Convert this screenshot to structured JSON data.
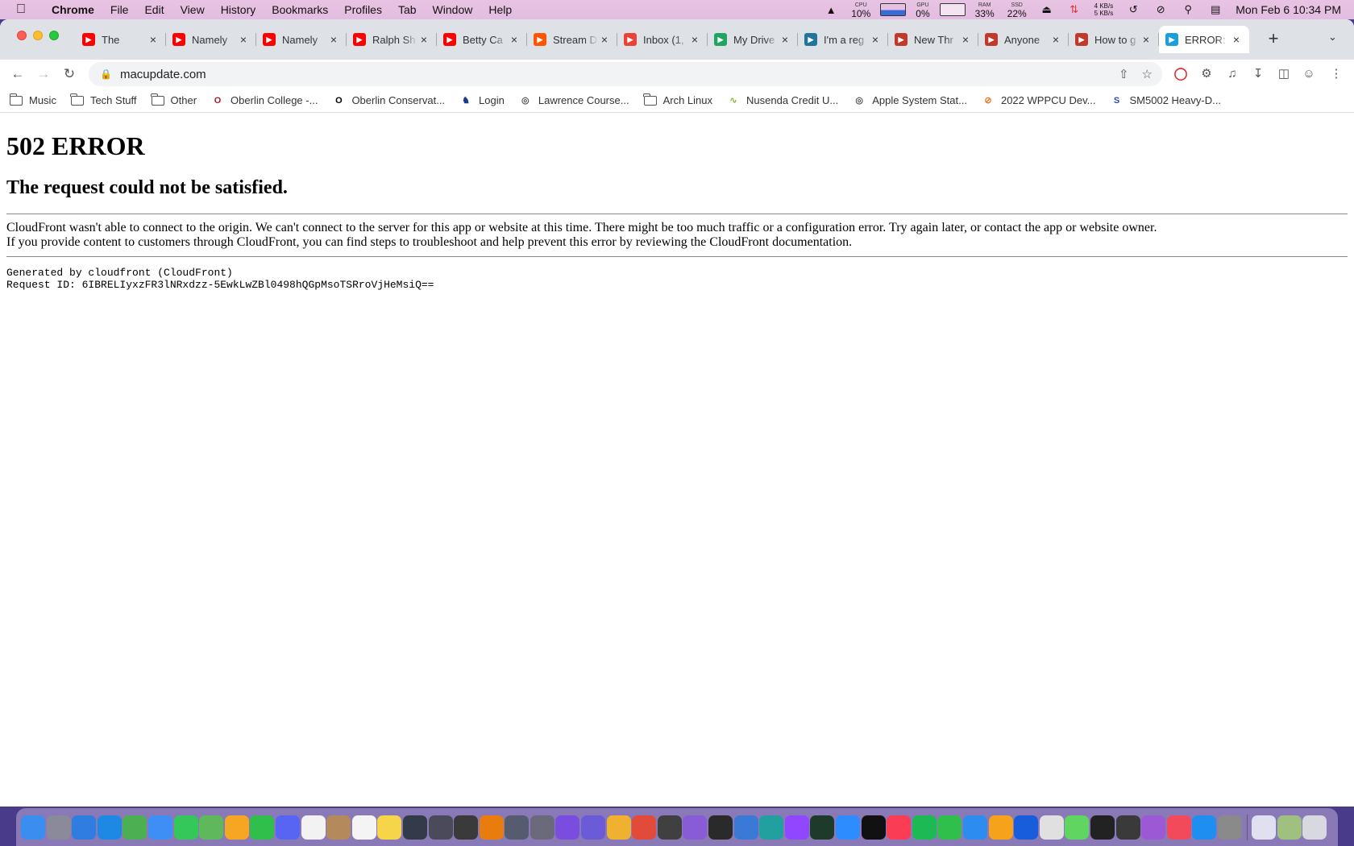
{
  "menubar": {
    "app": "Chrome",
    "items": [
      "File",
      "Edit",
      "View",
      "History",
      "Bookmarks",
      "Profiles",
      "Tab",
      "Window",
      "Help"
    ],
    "cpu": {
      "label": "CPU",
      "value": "10%"
    },
    "gpu": {
      "label": "GPU",
      "value": "0%"
    },
    "ram": {
      "label": "RAM",
      "value": "33%"
    },
    "ssd": {
      "label": "SSD",
      "value": "22%"
    },
    "net_up": "4 KB/s",
    "net_down": "5 KB/s",
    "clock": "Mon Feb 6  10:34 PM"
  },
  "tabs": [
    {
      "title": "The",
      "icon": "youtube-icon",
      "color": "#ff0000"
    },
    {
      "title": "Namely",
      "icon": "youtube-icon",
      "color": "#ff0000"
    },
    {
      "title": "Namely",
      "icon": "youtube-icon",
      "color": "#ff0000"
    },
    {
      "title": "Ralph Sh",
      "icon": "youtube-icon",
      "color": "#ff0000"
    },
    {
      "title": "Betty Ca",
      "icon": "youtube-icon",
      "color": "#ff0000"
    },
    {
      "title": "Stream D",
      "icon": "soundcloud-icon",
      "color": "#ff5500"
    },
    {
      "title": "Inbox (1,",
      "icon": "gmail-icon",
      "color": "#ea4335"
    },
    {
      "title": "My Drive",
      "icon": "google-drive-icon",
      "color": "#1fa463"
    },
    {
      "title": "I'm a reg",
      "icon": "wordpress-icon",
      "color": "#21759b"
    },
    {
      "title": "New Thr",
      "icon": "macrumors-icon",
      "color": "#c0392b"
    },
    {
      "title": "Anyone",
      "icon": "macrumors-icon",
      "color": "#c0392b"
    },
    {
      "title": "How to g",
      "icon": "macrumors-icon",
      "color": "#c0392b"
    },
    {
      "title": "ERROR:",
      "icon": "macupdate-icon",
      "color": "#1a9fd8"
    }
  ],
  "address": "macupdate.com",
  "bookmarks": [
    {
      "label": "Music",
      "icon": "folder-icon"
    },
    {
      "label": "Tech Stuff",
      "icon": "folder-icon"
    },
    {
      "label": "Other",
      "icon": "folder-icon"
    },
    {
      "label": "Oberlin College -...",
      "icon": "oberlin-icon"
    },
    {
      "label": "Oberlin Conservat...",
      "icon": "conservatory-icon"
    },
    {
      "label": "Login",
      "icon": "login-icon"
    },
    {
      "label": "Lawrence Course...",
      "icon": "globe-icon"
    },
    {
      "label": "Arch Linux",
      "icon": "folder-icon"
    },
    {
      "label": "Nusenda Credit U...",
      "icon": "nusenda-icon"
    },
    {
      "label": "Apple System Stat...",
      "icon": "globe-icon"
    },
    {
      "label": "2022 WPPCU Dev...",
      "icon": "wppcu-icon"
    },
    {
      "label": "SM5002 Heavy-D...",
      "icon": "s-icon"
    }
  ],
  "page": {
    "heading": "502 ERROR",
    "subheading": "The request could not be satisfied.",
    "message1": "CloudFront wasn't able to connect to the origin. We can't connect to the server for this app or website at this time. There might be too much traffic or a configuration error. Try again later, or contact the app or website owner.",
    "message2": "If you provide content to customers through CloudFront, you can find steps to troubleshoot and help prevent this error by reviewing the CloudFront documentation.",
    "generated_by": "Generated by cloudfront (CloudFront)",
    "request_id": "Request ID: 6IBRELIyxzFR3lNRxdzz-5EwkLwZBl0498hQGpMsoTSRroVjHeMsiQ=="
  },
  "dock": [
    {
      "icon": "finder-icon",
      "color": "#3a8ef0"
    },
    {
      "icon": "launchpad-icon",
      "color": "#8a8a9a"
    },
    {
      "icon": "files-icon",
      "color": "#2f7de1"
    },
    {
      "icon": "safari-icon",
      "color": "#1e88e5"
    },
    {
      "icon": "chrome-icon",
      "color": "#4caf50"
    },
    {
      "icon": "mail-icon",
      "color": "#3d8ff5"
    },
    {
      "icon": "messages-icon",
      "color": "#34c759"
    },
    {
      "icon": "maps-icon",
      "color": "#5fb85a"
    },
    {
      "icon": "photos-icon",
      "color": "#f6a623"
    },
    {
      "icon": "facetime-icon",
      "color": "#2fbf4a"
    },
    {
      "icon": "discord-icon",
      "color": "#5865f2"
    },
    {
      "icon": "calendar-icon",
      "color": "#f2f2f2"
    },
    {
      "icon": "contacts-icon",
      "color": "#b48a5a"
    },
    {
      "icon": "reminders-icon",
      "color": "#f4f4f4"
    },
    {
      "icon": "notes-icon",
      "color": "#f7d54a"
    },
    {
      "icon": "davinci-icon",
      "color": "#333a4a"
    },
    {
      "icon": "app-icon",
      "color": "#4a4a5a"
    },
    {
      "icon": "app-icon",
      "color": "#3a3a3a"
    },
    {
      "icon": "blender-icon",
      "color": "#e87d0d"
    },
    {
      "icon": "app-icon",
      "color": "#555c70"
    },
    {
      "icon": "app-icon",
      "color": "#6a6a7a"
    },
    {
      "icon": "arc-icon",
      "color": "#7a4de0"
    },
    {
      "icon": "musescore-icon",
      "color": "#6b5bd6"
    },
    {
      "icon": "app-icon",
      "color": "#f0b030"
    },
    {
      "icon": "app-icon",
      "color": "#e24a3a"
    },
    {
      "icon": "app-icon",
      "color": "#404040"
    },
    {
      "icon": "app-icon",
      "color": "#8a5bd6"
    },
    {
      "icon": "obs-icon",
      "color": "#2a2a2a"
    },
    {
      "icon": "app-icon",
      "color": "#3a7ad6"
    },
    {
      "icon": "app-icon",
      "color": "#22a0a0"
    },
    {
      "icon": "twitch-icon",
      "color": "#9146ff"
    },
    {
      "icon": "terminal-icon",
      "color": "#1d3a2a"
    },
    {
      "icon": "zoom-icon",
      "color": "#2d8cff"
    },
    {
      "icon": "appletv-icon",
      "color": "#111111"
    },
    {
      "icon": "music-icon",
      "color": "#fa3c55"
    },
    {
      "icon": "spotify-icon",
      "color": "#1db954"
    },
    {
      "icon": "numbers-icon",
      "color": "#2fbf4a"
    },
    {
      "icon": "keynote-icon",
      "color": "#2d8cf0"
    },
    {
      "icon": "pages-icon",
      "color": "#f7a21b"
    },
    {
      "icon": "bitwarden-icon",
      "color": "#175ddc"
    },
    {
      "icon": "preview-icon",
      "color": "#e0e0e0"
    },
    {
      "icon": "app-icon",
      "color": "#5fd65f"
    },
    {
      "icon": "terminal-icon",
      "color": "#222222"
    },
    {
      "icon": "app-icon",
      "color": "#3a3a3a"
    },
    {
      "icon": "podcasts-icon",
      "color": "#9b59d6"
    },
    {
      "icon": "news-icon",
      "color": "#f24a5a"
    },
    {
      "icon": "appstore-icon",
      "color": "#1f8ef1"
    },
    {
      "icon": "settings-icon",
      "color": "#8a8a8a"
    },
    {
      "icon": "downloads-icon",
      "color": "#e0e0f0"
    },
    {
      "icon": "screenshot-icon",
      "color": "#a0c080"
    },
    {
      "icon": "trash-icon",
      "color": "#d8d8e0"
    }
  ]
}
